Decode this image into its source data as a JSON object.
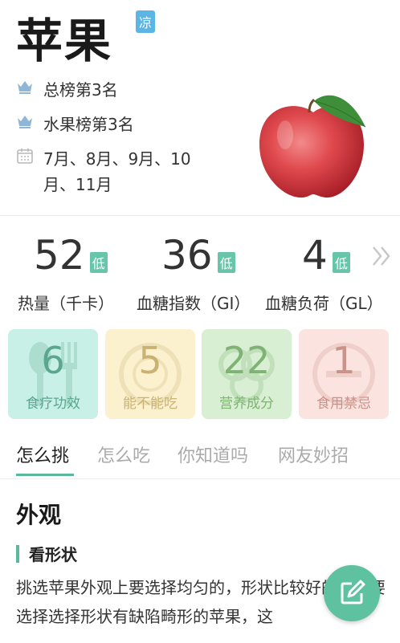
{
  "header": {
    "title": "苹果",
    "badge": "凉"
  },
  "info": [
    {
      "icon": "crown-icon",
      "text": "总榜第3名"
    },
    {
      "icon": "crown-icon",
      "text": "水果榜第3名"
    },
    {
      "icon": "calendar-icon",
      "text": "7月、8月、9月、10月、11月"
    }
  ],
  "metrics": [
    {
      "value": "52",
      "tag": "低",
      "label": "热量（千卡）"
    },
    {
      "value": "36",
      "tag": "低",
      "label": "血糖指数（GI）"
    },
    {
      "value": "4",
      "tag": "低",
      "label": "血糖负荷（GL）"
    }
  ],
  "cards": [
    {
      "value": "6",
      "label": "食疗功效",
      "bg": "#c9f0e6",
      "color": "#5aa68f"
    },
    {
      "value": "5",
      "label": "能不能吃",
      "bg": "#fcf1cf",
      "color": "#c9b272"
    },
    {
      "value": "22",
      "label": "营养成分",
      "bg": "#d8efd3",
      "color": "#7fb373"
    },
    {
      "value": "1",
      "label": "食用禁忌",
      "bg": "#fbe4df",
      "color": "#c9938a"
    }
  ],
  "tabs": [
    "怎么挑",
    "怎么吃",
    "你知道吗",
    "网友妙招"
  ],
  "content": {
    "section_title": "外观",
    "subsection_title": "看形状",
    "body": "挑选苹果外观上要选择均匀的，形状比较好的，不要选择选择形状有缺陷畸形的苹果，这"
  },
  "colors": {
    "accent": "#5ab89c",
    "badge": "#5bb6e6",
    "tag": "#67c6a9"
  }
}
